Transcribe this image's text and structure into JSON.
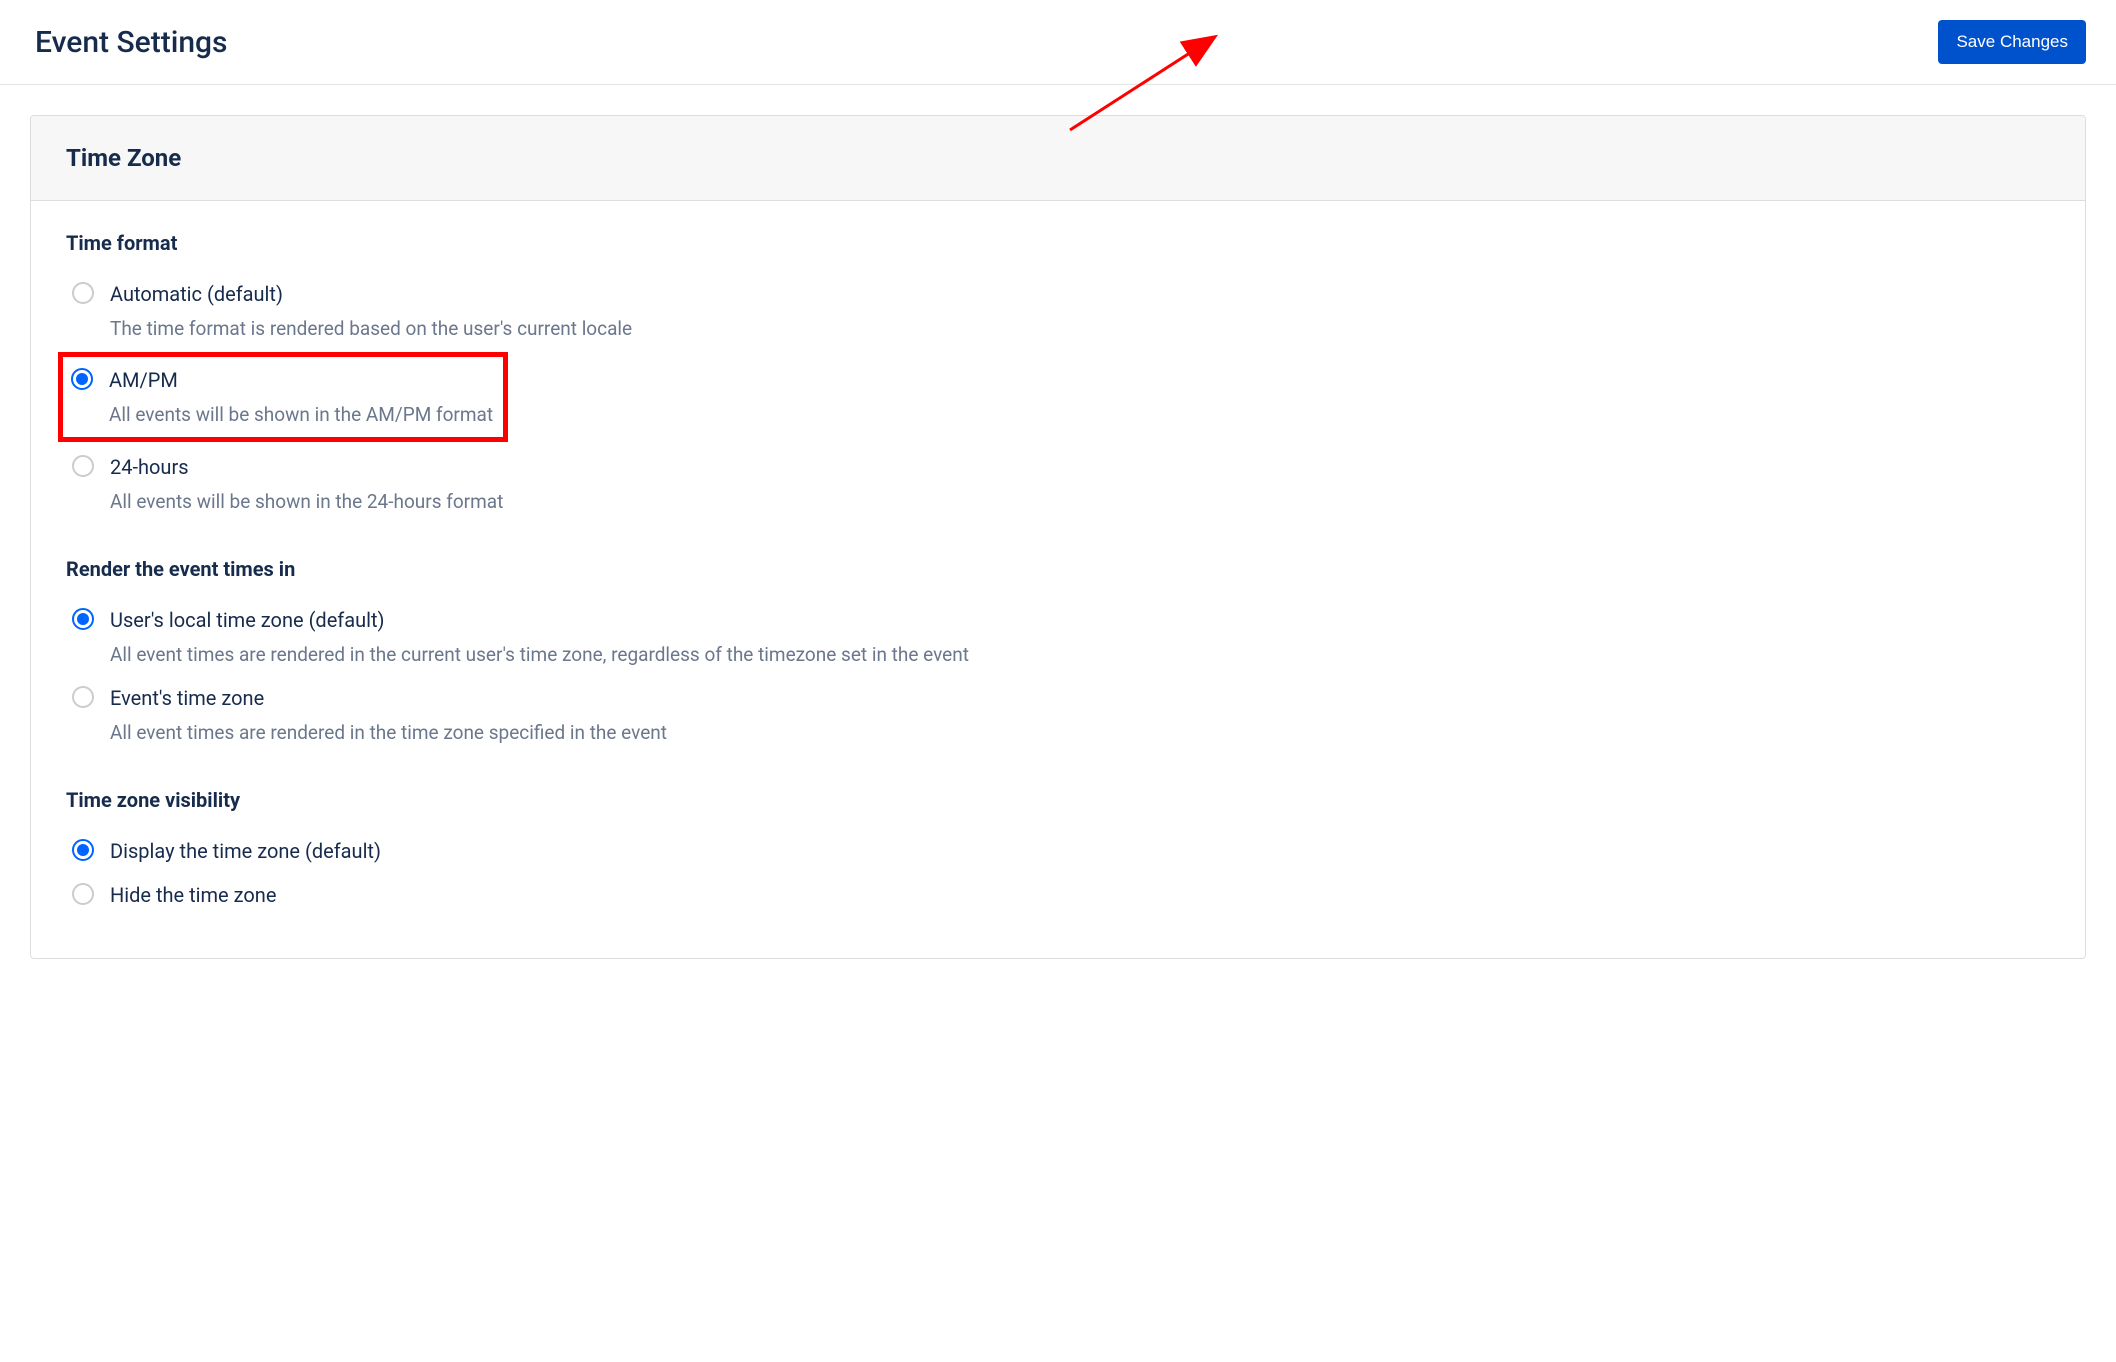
{
  "header": {
    "title": "Event Settings",
    "save_button": "Save Changes"
  },
  "panel": {
    "title": "Time Zone"
  },
  "sections": {
    "time_format": {
      "label": "Time format",
      "options": [
        {
          "label": "Automatic (default)",
          "desc": "The time format is rendered based on the user's current locale",
          "selected": false
        },
        {
          "label": "AM/PM",
          "desc": "All events will be shown in the AM/PM format",
          "selected": true,
          "highlighted": true
        },
        {
          "label": "24-hours",
          "desc": "All events will be shown in the 24-hours format",
          "selected": false
        }
      ]
    },
    "render_in": {
      "label": "Render the event times in",
      "options": [
        {
          "label": "User's local time zone (default)",
          "desc": "All event times are rendered in the current user's time zone, regardless of the timezone set in the event",
          "selected": true
        },
        {
          "label": "Event's time zone",
          "desc": "All event times are rendered in the time zone specified in the event",
          "selected": false
        }
      ]
    },
    "visibility": {
      "label": "Time zone visibility",
      "options": [
        {
          "label": "Display the time zone (default)",
          "selected": true
        },
        {
          "label": "Hide the time zone",
          "selected": false
        }
      ]
    }
  }
}
